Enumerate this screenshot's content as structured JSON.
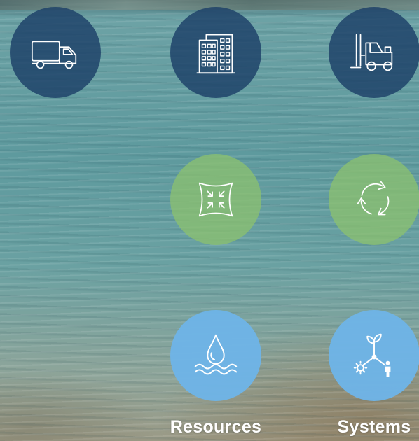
{
  "icons": [
    {
      "name": "truck-icon",
      "color": "#1c4068"
    },
    {
      "name": "buildings-icon",
      "color": "#1c4068"
    },
    {
      "name": "forklift-icon",
      "color": "#1c4068"
    },
    {
      "name": "compress-icon",
      "color": "#8cc26e"
    },
    {
      "name": "recycle-icon",
      "color": "#8cc26e"
    },
    {
      "name": "water-drop-icon",
      "color": "#6eb4e6"
    },
    {
      "name": "plant-sun-person-icon",
      "color": "#6eb4e6"
    }
  ],
  "labels": {
    "resources": "Resources",
    "systems": "Systems"
  }
}
